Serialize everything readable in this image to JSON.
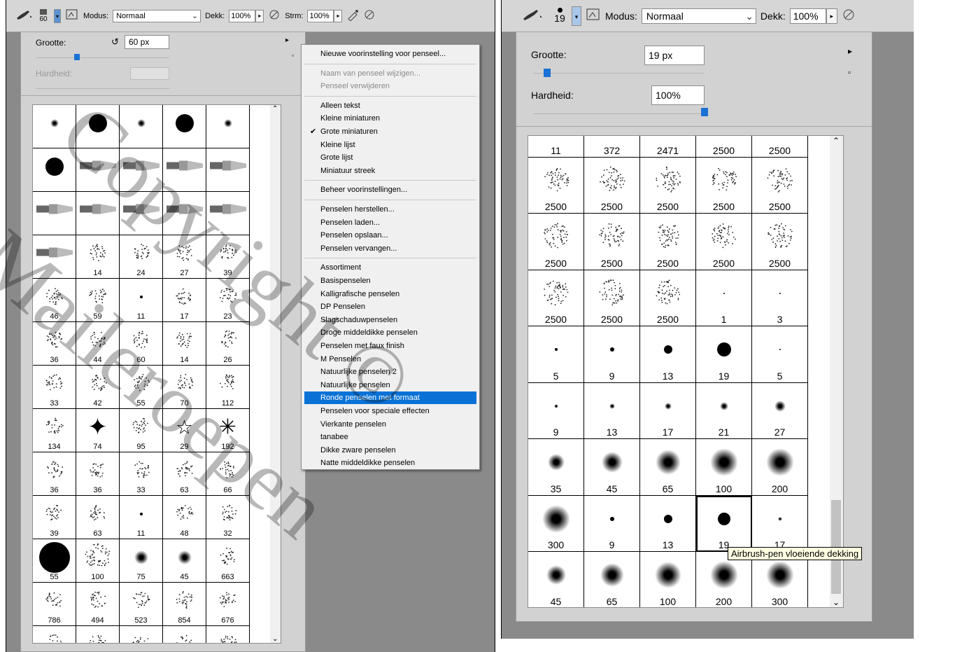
{
  "left": {
    "toolbar": {
      "brush_size": "60",
      "mode_label": "Modus:",
      "mode_value": "Normaal",
      "opacity_label": "Dekk:",
      "opacity_value": "100%",
      "flow_label": "Strm:",
      "flow_value": "100%"
    },
    "panel": {
      "size_label": "Grootte:",
      "size_value": "60 px",
      "hardness_label": "Hardheid:"
    },
    "brush_labels": [
      "",
      "",
      "",
      "",
      "",
      "",
      "",
      "",
      "",
      "",
      "",
      "",
      "",
      "",
      "",
      "",
      "14",
      "24",
      "27",
      "39",
      "46",
      "59",
      "11",
      "17",
      "23",
      "36",
      "44",
      "60",
      "14",
      "26",
      "33",
      "42",
      "55",
      "70",
      "112",
      "134",
      "74",
      "95",
      "29",
      "192",
      "36",
      "36",
      "33",
      "63",
      "66",
      "39",
      "63",
      "11",
      "48",
      "32",
      "55",
      "100",
      "75",
      "45",
      "663",
      "786",
      "494",
      "523",
      "854",
      "676",
      "",
      "",
      "",
      "",
      ""
    ],
    "menu": {
      "items": [
        "Nieuwe voorinstelling voor penseel...",
        "Naam van penseel wijzigen...",
        "Penseel verwijderen",
        "Alleen tekst",
        "Kleine miniaturen",
        "Grote miniaturen",
        "Kleine lijst",
        "Grote lijst",
        "Miniatuur streek",
        "Beheer voorinstellingen...",
        "Penselen herstellen...",
        "Penselen laden...",
        "Penselen opslaan...",
        "Penselen vervangen...",
        "Assortiment",
        "Basispenselen",
        "Kalligrafische penselen",
        "DP Penselen",
        "Slagschaduwpenselen",
        "Droge middeldikke penselen",
        "Penselen met faux finish",
        "M Penselen",
        "Natuurlijke penselen 2",
        "Natuurlijke penselen",
        "Ronde penselen met formaat",
        "Penselen voor speciale effecten",
        "Vierkante penselen",
        "tanabee",
        "Dikke zware penselen",
        "Natte middeldikke penselen"
      ],
      "disabled": [
        1,
        2
      ],
      "checked": 5,
      "highlighted": 24,
      "check_mark": "✔"
    }
  },
  "right": {
    "toolbar": {
      "brush_size": "19",
      "mode_label": "Modus:",
      "mode_value": "Normaal",
      "opacity_label": "Dekk:",
      "opacity_value": "100%"
    },
    "panel": {
      "size_label": "Grootte:",
      "size_value": "19 px",
      "hardness_label": "Hardheid:",
      "hardness_value": "100%"
    },
    "brush_labels": [
      "11",
      "372",
      "2471",
      "2500",
      "2500",
      "2500",
      "2500",
      "2500",
      "2500",
      "2500",
      "2500",
      "2500",
      "2500",
      "2500",
      "2500",
      "2500",
      "2500",
      "2500",
      "1",
      "3",
      "5",
      "9",
      "13",
      "19",
      "5",
      "9",
      "13",
      "17",
      "21",
      "27",
      "35",
      "45",
      "65",
      "100",
      "200",
      "300",
      "9",
      "13",
      "19",
      "17",
      "45",
      "65",
      "100",
      "200",
      "300"
    ],
    "tooltip": "Airbrush-pen vloeiende dekking"
  },
  "watermark": {
    "line1": "Copyright ©",
    "line2": "Maileroepen"
  }
}
